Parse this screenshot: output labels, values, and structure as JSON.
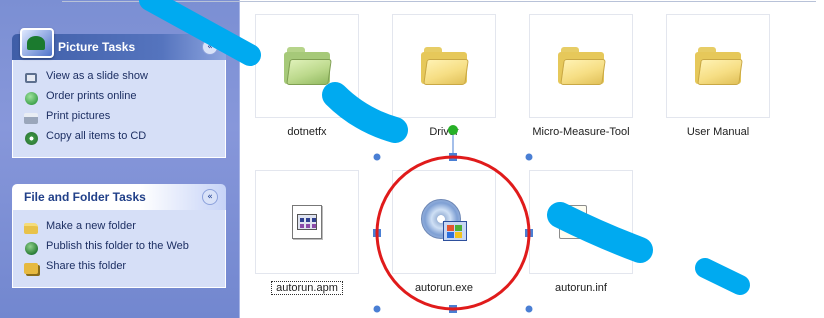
{
  "task_pane": {
    "picture_tasks": {
      "title": "Picture Tasks",
      "collapse_glyph": "«",
      "items": [
        {
          "icon": "slideshow-icon",
          "label": "View as a slide show"
        },
        {
          "icon": "order-prints-icon",
          "label": "Order prints online"
        },
        {
          "icon": "printer-icon",
          "label": "Print pictures"
        },
        {
          "icon": "cd-burn-icon",
          "label": "Copy all items to CD"
        }
      ]
    },
    "file_folder_tasks": {
      "title": "File and Folder Tasks",
      "collapse_glyph": "«",
      "items": [
        {
          "icon": "new-folder-icon",
          "label": "Make a new folder"
        },
        {
          "icon": "publish-web-icon",
          "label": "Publish this folder to the Web"
        },
        {
          "icon": "share-folder-icon",
          "label": "Share this folder"
        }
      ]
    }
  },
  "files": [
    {
      "name": "dotnetfx",
      "type": "folder",
      "icon": "green-folder-icon"
    },
    {
      "name": "Driver",
      "type": "folder",
      "icon": "folder-icon"
    },
    {
      "name": "Micro-Measure-Tool",
      "type": "folder",
      "icon": "folder-icon"
    },
    {
      "name": "User Manual",
      "type": "folder",
      "icon": "folder-icon"
    },
    {
      "name": "autorun.apm",
      "type": "file",
      "icon": "document-icon",
      "selected": true
    },
    {
      "name": "autorun.exe",
      "type": "file",
      "icon": "cd-setup-icon"
    },
    {
      "name": "autorun.inf",
      "type": "file",
      "icon": "config-file-icon"
    }
  ],
  "annotation": {
    "shape": "circle",
    "stroke_color": "#e01b1b",
    "handle_color": "#4a7fd4",
    "rotate_handle_color": "#27b027",
    "watermark_color": "#00aaf0"
  }
}
